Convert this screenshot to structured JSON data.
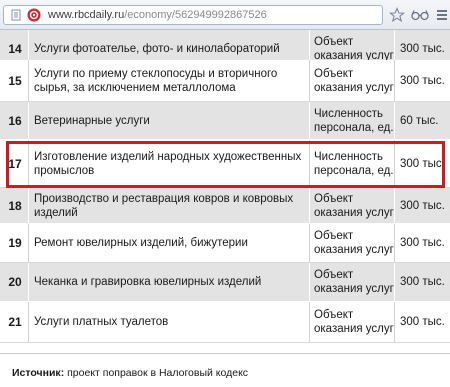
{
  "browser": {
    "url_host": "www.rbcdaily.ru",
    "url_path": "/economy/562949992867526"
  },
  "table": {
    "rows": [
      {
        "num": "14",
        "name": "Услуги фотоателье, фото- и кинолабораторий",
        "type": "Объект оказания услуг",
        "value": "300 тыс."
      },
      {
        "num": "15",
        "name": "Услуги по приему стеклопосуды и вторичного сырья, за исключением металлолома",
        "type": "Объект оказания услуг",
        "value": "300 тыс."
      },
      {
        "num": "16",
        "name": "Ветеринарные услуги",
        "type": "Численность персонала, ед.",
        "value": "60 тыс."
      },
      {
        "num": "17",
        "name": "Изготовление изделий народных художественных промыслов",
        "type": "Численность персонала, ед.",
        "value": "300 тыс."
      },
      {
        "num": "18",
        "name": "Производство и реставрация ковров и ковровых изделий",
        "type": "Объект оказания услуг",
        "value": "300 тыс."
      },
      {
        "num": "19",
        "name": "Ремонт ювелирных изделий, бижутерии",
        "type": "Объект оказания услуг",
        "value": "300 тыс."
      },
      {
        "num": "20",
        "name": "Чеканка и гравировка ювелирных изделий",
        "type": "Объект оказания услуг",
        "value": "300 тыс."
      },
      {
        "num": "21",
        "name": "Услуги платных туалетов",
        "type": "Объект оказания услуг",
        "value": "300 тыс."
      }
    ]
  },
  "source": {
    "label": "Источник:",
    "text": "проект поправок в Налоговый кодекс"
  },
  "colors": {
    "highlight": "#d51820",
    "odd_row": "#e3e3e3"
  }
}
